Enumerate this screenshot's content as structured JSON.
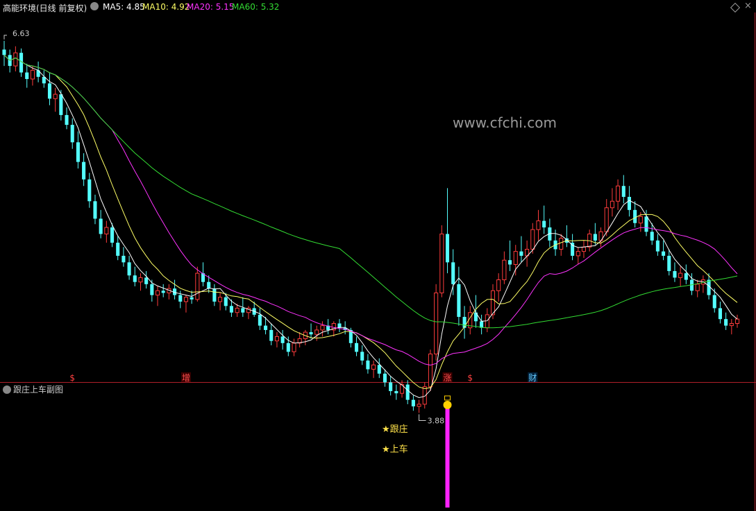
{
  "header": {
    "stock_title": "高能环境(日线 前复权)",
    "ma_items": [
      {
        "label": "MA5: 4.85",
        "color": "#ffffff"
      },
      {
        "label": "MA10: 4.92",
        "color": "#ffff66"
      },
      {
        "label": "MA20: 5.15",
        "color": "#ff33ff"
      },
      {
        "label": "MA60: 5.32",
        "color": "#33dd33"
      }
    ],
    "icons": [
      "chevron-down-icon",
      "diamond-icon",
      "close-icon"
    ]
  },
  "sub_panel": {
    "title": "跟庄上车副图",
    "signal_labels": [
      "★跟庄",
      "★上车"
    ],
    "colors": {
      "bar": "#ff22ff",
      "ball": "#ffd000",
      "text": "#ffe24a"
    }
  },
  "watermark": "www.cfchi.com",
  "event_markers": [
    {
      "label": "$",
      "index": 12,
      "color": "#ff4040",
      "bg": "#000000"
    },
    {
      "label": "增",
      "index": 32,
      "color": "#ff5050",
      "bg": "#3a0000"
    },
    {
      "label": "涨",
      "index": 78,
      "color": "#ff5050",
      "bg": "#3a0000"
    },
    {
      "label": "$",
      "index": 82,
      "color": "#ff4040",
      "bg": "#000000"
    },
    {
      "label": "财",
      "index": 93,
      "color": "#66ccff",
      "bg": "#00203a"
    }
  ],
  "colors": {
    "up": "#ff3c3c",
    "down": "#54ffff",
    "frame": "#b0202a",
    "bg": "#000000"
  },
  "chart_data": {
    "type": "candlestick",
    "ylim": [
      3.7,
      6.75
    ],
    "high_label": "6.63",
    "low_label": "3.88",
    "ohlc": [
      [
        6.55,
        6.63,
        6.4,
        6.5
      ],
      [
        6.5,
        6.55,
        6.34,
        6.4
      ],
      [
        6.4,
        6.58,
        6.35,
        6.52
      ],
      [
        6.52,
        6.56,
        6.3,
        6.34
      ],
      [
        6.34,
        6.42,
        6.2,
        6.28
      ],
      [
        6.28,
        6.4,
        6.22,
        6.36
      ],
      [
        6.36,
        6.44,
        6.25,
        6.3
      ],
      [
        6.3,
        6.36,
        6.2,
        6.24
      ],
      [
        6.24,
        6.34,
        6.04,
        6.1
      ],
      [
        6.1,
        6.2,
        5.98,
        6.14
      ],
      [
        6.14,
        6.18,
        5.9,
        5.95
      ],
      [
        5.95,
        6.02,
        5.82,
        5.86
      ],
      [
        5.86,
        5.92,
        5.64,
        5.7
      ],
      [
        5.7,
        5.8,
        5.46,
        5.52
      ],
      [
        5.52,
        5.6,
        5.3,
        5.36
      ],
      [
        5.36,
        5.42,
        5.1,
        5.16
      ],
      [
        5.16,
        5.22,
        4.95,
        5.0
      ],
      [
        5.0,
        5.08,
        4.82,
        4.86
      ],
      [
        4.86,
        4.98,
        4.78,
        4.92
      ],
      [
        4.92,
        4.96,
        4.74,
        4.78
      ],
      [
        4.78,
        4.84,
        4.62,
        4.66
      ],
      [
        4.66,
        4.74,
        4.56,
        4.6
      ],
      [
        4.6,
        4.66,
        4.44,
        4.48
      ],
      [
        4.48,
        4.56,
        4.38,
        4.42
      ],
      [
        4.42,
        4.5,
        4.34,
        4.46
      ],
      [
        4.46,
        4.52,
        4.36,
        4.4
      ],
      [
        4.4,
        4.44,
        4.24,
        4.3
      ],
      [
        4.3,
        4.38,
        4.2,
        4.34
      ],
      [
        4.34,
        4.4,
        4.28,
        4.32
      ],
      [
        4.32,
        4.4,
        4.26,
        4.36
      ],
      [
        4.36,
        4.44,
        4.26,
        4.3
      ],
      [
        4.3,
        4.34,
        4.18,
        4.24
      ],
      [
        4.24,
        4.3,
        4.14,
        4.28
      ],
      [
        4.28,
        4.34,
        4.22,
        4.26
      ],
      [
        4.26,
        4.56,
        4.24,
        4.5
      ],
      [
        4.5,
        4.6,
        4.38,
        4.42
      ],
      [
        4.42,
        4.48,
        4.32,
        4.36
      ],
      [
        4.36,
        4.4,
        4.2,
        4.24
      ],
      [
        4.24,
        4.32,
        4.16,
        4.28
      ],
      [
        4.28,
        4.32,
        4.16,
        4.2
      ],
      [
        4.2,
        4.26,
        4.1,
        4.14
      ],
      [
        4.14,
        4.22,
        4.1,
        4.18
      ],
      [
        4.18,
        4.28,
        4.1,
        4.14
      ],
      [
        4.14,
        4.2,
        4.08,
        4.18
      ],
      [
        4.18,
        4.24,
        4.1,
        4.12
      ],
      [
        4.12,
        4.18,
        3.98,
        4.02
      ],
      [
        4.02,
        4.1,
        3.94,
        3.98
      ],
      [
        3.98,
        4.04,
        3.84,
        3.88
      ],
      [
        3.88,
        3.96,
        3.82,
        3.92
      ],
      [
        3.92,
        3.98,
        3.8,
        3.86
      ],
      [
        3.86,
        3.92,
        3.74,
        3.78
      ],
      [
        3.78,
        3.9,
        3.74,
        3.86
      ],
      [
        3.86,
        3.96,
        3.82,
        3.9
      ],
      [
        3.9,
        3.98,
        3.84,
        3.96
      ],
      [
        3.96,
        4.04,
        3.9,
        3.94
      ],
      [
        3.94,
        4.02,
        3.88,
        3.98
      ],
      [
        3.98,
        4.06,
        3.92,
        4.02
      ],
      [
        4.02,
        4.08,
        3.94,
        3.98
      ],
      [
        3.98,
        4.06,
        3.92,
        4.04
      ],
      [
        4.04,
        4.08,
        3.96,
        4.0
      ],
      [
        4.0,
        4.06,
        3.94,
        3.98
      ],
      [
        3.98,
        4.0,
        3.82,
        3.86
      ],
      [
        3.86,
        3.92,
        3.74,
        3.78
      ],
      [
        3.78,
        3.84,
        3.66,
        3.7
      ],
      [
        3.7,
        3.76,
        3.58,
        3.62
      ],
      [
        3.62,
        3.7,
        3.54,
        3.66
      ],
      [
        3.66,
        3.72,
        3.54,
        3.58
      ],
      [
        3.58,
        3.62,
        3.46,
        3.5
      ],
      [
        3.5,
        3.56,
        3.38,
        3.42
      ],
      [
        3.42,
        3.48,
        3.34,
        3.4
      ],
      [
        3.4,
        3.52,
        3.36,
        3.48
      ],
      [
        3.48,
        3.52,
        3.3,
        3.34
      ],
      [
        3.34,
        3.38,
        3.24,
        3.28
      ],
      [
        3.28,
        3.34,
        3.22,
        3.3
      ],
      [
        3.3,
        3.5,
        3.26,
        3.46
      ],
      [
        3.46,
        3.8,
        3.42,
        3.76
      ],
      [
        3.76,
        4.4,
        3.7,
        4.32
      ],
      [
        4.32,
        4.94,
        4.28,
        4.86
      ],
      [
        4.86,
        5.28,
        4.5,
        4.6
      ],
      [
        4.6,
        4.72,
        4.3,
        4.4
      ],
      [
        4.4,
        4.56,
        4.02,
        4.1
      ],
      [
        4.1,
        4.2,
        3.9,
        4.0
      ],
      [
        4.0,
        4.2,
        3.94,
        4.14
      ],
      [
        4.14,
        4.3,
        4.0,
        4.06
      ],
      [
        4.06,
        4.12,
        3.94,
        4.0
      ],
      [
        4.0,
        4.18,
        3.96,
        4.12
      ],
      [
        4.12,
        4.4,
        4.08,
        4.34
      ],
      [
        4.34,
        4.5,
        4.24,
        4.44
      ],
      [
        4.44,
        4.7,
        4.4,
        4.62
      ],
      [
        4.62,
        4.8,
        4.52,
        4.58
      ],
      [
        4.58,
        4.76,
        4.48,
        4.7
      ],
      [
        4.7,
        4.84,
        4.6,
        4.66
      ],
      [
        4.66,
        4.8,
        4.56,
        4.72
      ],
      [
        4.72,
        4.96,
        4.68,
        4.9
      ],
      [
        4.9,
        5.08,
        4.8,
        4.98
      ],
      [
        4.98,
        5.12,
        4.86,
        4.92
      ],
      [
        4.92,
        5.0,
        4.74,
        4.8
      ],
      [
        4.8,
        4.9,
        4.66,
        4.72
      ],
      [
        4.72,
        4.86,
        4.66,
        4.82
      ],
      [
        4.82,
        4.94,
        4.74,
        4.78
      ],
      [
        4.78,
        4.86,
        4.62,
        4.66
      ],
      [
        4.66,
        4.74,
        4.58,
        4.7
      ],
      [
        4.7,
        4.8,
        4.64,
        4.74
      ],
      [
        4.74,
        4.9,
        4.7,
        4.86
      ],
      [
        4.86,
        4.96,
        4.76,
        4.8
      ],
      [
        4.8,
        4.92,
        4.74,
        4.88
      ],
      [
        4.88,
        5.18,
        4.84,
        5.1
      ],
      [
        5.1,
        5.28,
        5.02,
        5.16
      ],
      [
        5.16,
        5.36,
        5.08,
        5.3
      ],
      [
        5.3,
        5.4,
        5.14,
        5.2
      ],
      [
        5.2,
        5.3,
        5.02,
        5.08
      ],
      [
        5.08,
        5.16,
        4.92,
        4.96
      ],
      [
        4.96,
        5.06,
        4.88,
        5.02
      ],
      [
        5.02,
        5.08,
        4.84,
        4.88
      ],
      [
        4.88,
        4.96,
        4.76,
        4.8
      ],
      [
        4.8,
        4.86,
        4.66,
        4.7
      ],
      [
        4.7,
        4.8,
        4.62,
        4.66
      ],
      [
        4.66,
        4.72,
        4.48,
        4.52
      ],
      [
        4.52,
        4.6,
        4.42,
        4.46
      ],
      [
        4.46,
        4.56,
        4.38,
        4.5
      ],
      [
        4.5,
        4.58,
        4.4,
        4.44
      ],
      [
        4.44,
        4.5,
        4.3,
        4.34
      ],
      [
        4.34,
        4.44,
        4.28,
        4.4
      ],
      [
        4.4,
        4.48,
        4.32,
        4.44
      ],
      [
        4.44,
        4.5,
        4.26,
        4.3
      ],
      [
        4.3,
        4.36,
        4.14,
        4.18
      ],
      [
        4.18,
        4.24,
        4.04,
        4.08
      ],
      [
        4.08,
        4.14,
        3.98,
        4.02
      ],
      [
        4.02,
        4.08,
        3.94,
        4.04
      ],
      [
        4.04,
        4.12,
        4.0,
        4.08
      ]
    ],
    "ma_series": [
      {
        "name": "MA5",
        "period": 5,
        "color": "#ffffff"
      },
      {
        "name": "MA10",
        "period": 10,
        "color": "#ffff66"
      },
      {
        "name": "MA20",
        "period": 20,
        "color": "#ff33ff"
      },
      {
        "name": "MA60",
        "period": 60,
        "color": "#33dd33"
      }
    ],
    "signal": {
      "index": 78,
      "label": "跟庄 上车"
    }
  }
}
